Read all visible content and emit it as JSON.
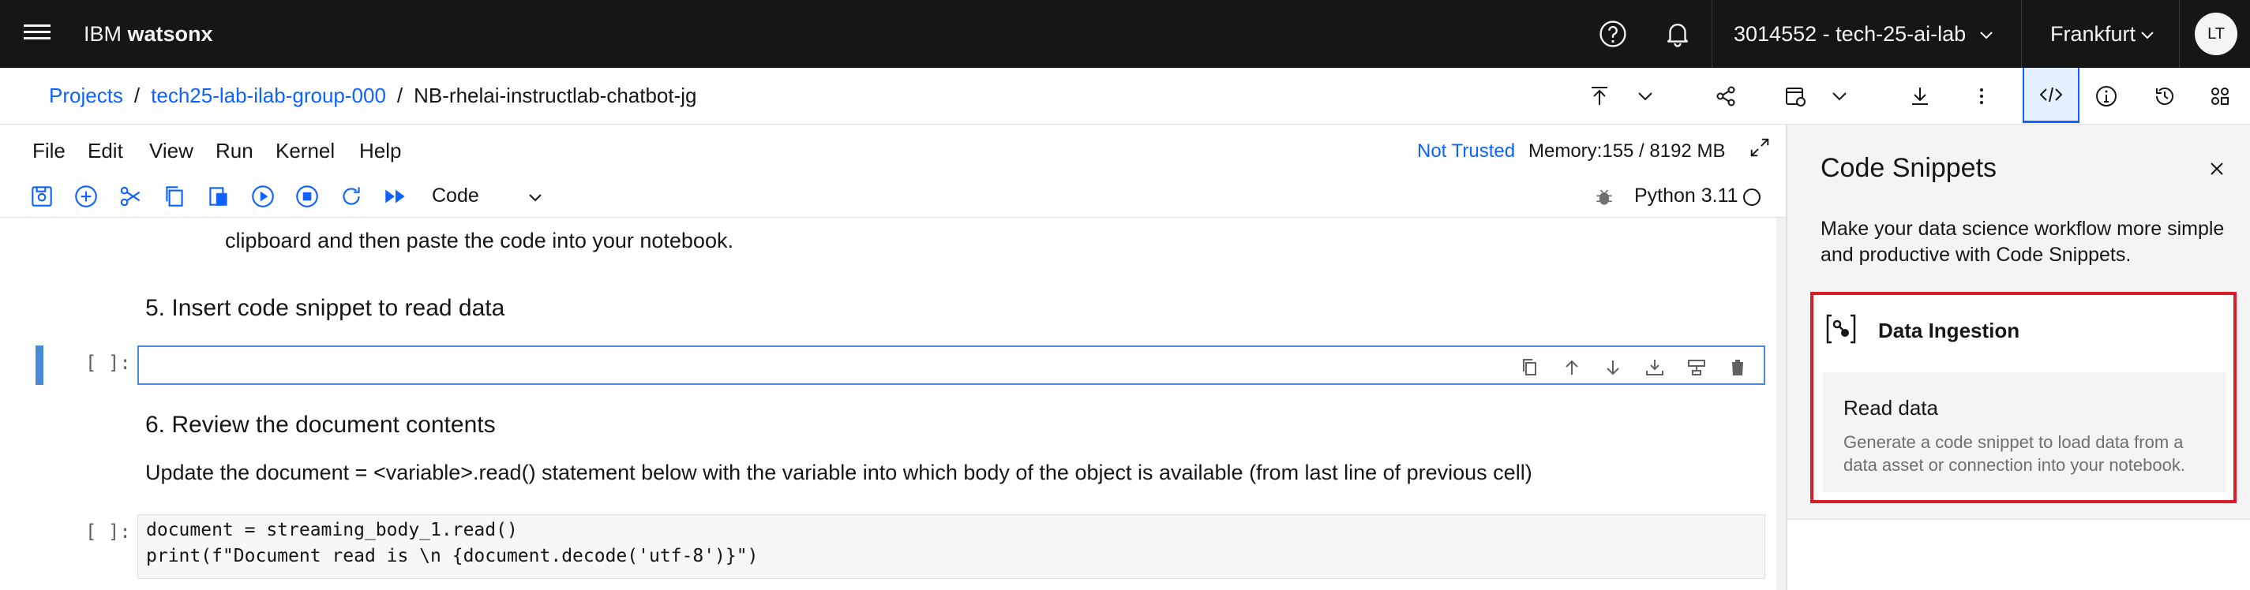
{
  "topbar": {
    "brand_prefix": "IBM",
    "brand_name": "watsonx",
    "account": "3014552 - tech-25-ai-lab",
    "region": "Frankfurt",
    "avatar_initials": "LT"
  },
  "breadcrumb": {
    "items": [
      "Projects",
      "tech25-lab-ilab-group-000"
    ],
    "separator": "/",
    "current": "NB-rhelai-instructlab-chatbot-jg"
  },
  "menubar": {
    "items": [
      "File",
      "Edit",
      "View",
      "Run",
      "Kernel",
      "Help"
    ],
    "trust_status": "Not Trusted",
    "memory": "Memory:155 / 8192 MB"
  },
  "toolbar": {
    "cell_type": "Code",
    "kernel": "Python 3.11"
  },
  "notebook": {
    "truncated_text": "clipboard and then paste the code into your notebook.",
    "heading_5": "5. Insert code snippet to read data",
    "empty_prompt": "[ ]:",
    "heading_6": "6. Review the document contents",
    "instruction": "Update the document = <variable>.read() statement below with the variable into which body of the object is available (from last line of previous cell)",
    "code_prompt": "[ ]:",
    "code_line_1": "document = streaming_body_1.read()",
    "code_line_2": "print(f\"Document read is \\n {document.decode('utf-8')}\")"
  },
  "panel": {
    "title": "Code Snippets",
    "description": "Make your data science workflow more simple and productive with Code Snippets.",
    "category_label": "Data Ingestion",
    "snippet_title": "Read data",
    "snippet_description": "Generate a code snippet to load data from a data asset or connection into your notebook."
  },
  "colors": {
    "topbar_bg": "#161616",
    "link_blue": "#0f62fe",
    "highlight_red": "#da1e28",
    "active_cell_blue": "#4a88d8"
  }
}
